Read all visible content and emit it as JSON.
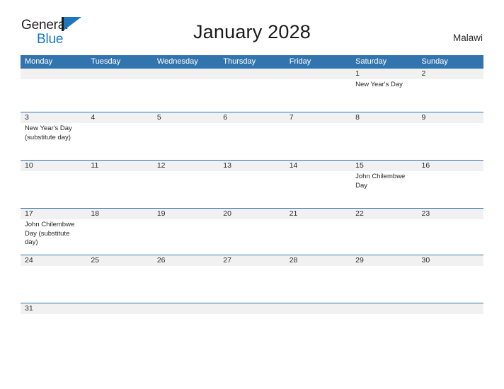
{
  "brand": {
    "name_part1": "General",
    "name_part2": "Blue",
    "flag_icon": "flag-icon",
    "accent_color": "#1f76bc"
  },
  "header": {
    "title": "January 2028",
    "country": "Malawi"
  },
  "theme": {
    "header_blue": "#3275ae",
    "row_band_gray": "#f1f1f1",
    "text_color": "#262626"
  },
  "calendar": {
    "month": "January",
    "year": "2028",
    "weekday_headers": [
      "Monday",
      "Tuesday",
      "Wednesday",
      "Thursday",
      "Friday",
      "Saturday",
      "Sunday"
    ],
    "weeks": [
      {
        "days": [
          {
            "number": "",
            "event": ""
          },
          {
            "number": "",
            "event": ""
          },
          {
            "number": "",
            "event": ""
          },
          {
            "number": "",
            "event": ""
          },
          {
            "number": "",
            "event": ""
          },
          {
            "number": "1",
            "event": "New Year's Day"
          },
          {
            "number": "2",
            "event": ""
          }
        ]
      },
      {
        "days": [
          {
            "number": "3",
            "event": "New Year's Day (substitute day)"
          },
          {
            "number": "4",
            "event": ""
          },
          {
            "number": "5",
            "event": ""
          },
          {
            "number": "6",
            "event": ""
          },
          {
            "number": "7",
            "event": ""
          },
          {
            "number": "8",
            "event": ""
          },
          {
            "number": "9",
            "event": ""
          }
        ]
      },
      {
        "days": [
          {
            "number": "10",
            "event": ""
          },
          {
            "number": "11",
            "event": ""
          },
          {
            "number": "12",
            "event": ""
          },
          {
            "number": "13",
            "event": ""
          },
          {
            "number": "14",
            "event": ""
          },
          {
            "number": "15",
            "event": "John Chilembwe Day"
          },
          {
            "number": "16",
            "event": ""
          }
        ]
      },
      {
        "days": [
          {
            "number": "17",
            "event": "John Chilembwe Day (substitute day)"
          },
          {
            "number": "18",
            "event": ""
          },
          {
            "number": "19",
            "event": ""
          },
          {
            "number": "20",
            "event": ""
          },
          {
            "number": "21",
            "event": ""
          },
          {
            "number": "22",
            "event": ""
          },
          {
            "number": "23",
            "event": ""
          }
        ]
      },
      {
        "days": [
          {
            "number": "24",
            "event": ""
          },
          {
            "number": "25",
            "event": ""
          },
          {
            "number": "26",
            "event": ""
          },
          {
            "number": "27",
            "event": ""
          },
          {
            "number": "28",
            "event": ""
          },
          {
            "number": "29",
            "event": ""
          },
          {
            "number": "30",
            "event": ""
          }
        ]
      },
      {
        "days": [
          {
            "number": "31",
            "event": ""
          },
          {
            "number": "",
            "event": ""
          },
          {
            "number": "",
            "event": ""
          },
          {
            "number": "",
            "event": ""
          },
          {
            "number": "",
            "event": ""
          },
          {
            "number": "",
            "event": ""
          },
          {
            "number": "",
            "event": ""
          }
        ]
      }
    ]
  }
}
